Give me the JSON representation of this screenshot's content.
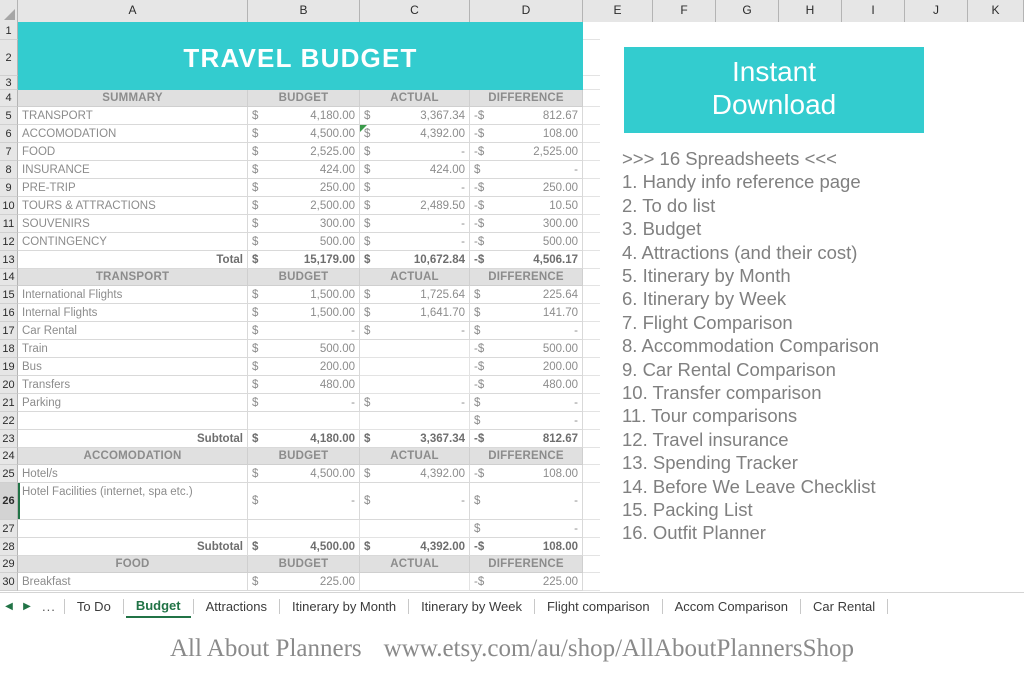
{
  "grid": {
    "column_headers": [
      "A",
      "B",
      "C",
      "D",
      "E",
      "F",
      "G",
      "H",
      "I",
      "J",
      "K"
    ],
    "row_numbers": [
      "1",
      "2",
      "3",
      "4",
      "5",
      "6",
      "7",
      "8",
      "9",
      "10",
      "11",
      "12",
      "13",
      "14",
      "15",
      "16",
      "17",
      "18",
      "19",
      "20",
      "21",
      "22",
      "23",
      "24",
      "25",
      "26",
      "27",
      "28",
      "29",
      "30"
    ],
    "selected_row": "26"
  },
  "banner": {
    "title": "TRAVEL BUDGET",
    "color": "#33cccf"
  },
  "summary": {
    "header": {
      "label": "SUMMARY",
      "budget": "BUDGET",
      "actual": "ACTUAL",
      "difference": "DIFFERENCE"
    },
    "rows": [
      {
        "label": "TRANSPORT",
        "budget_sym": "$",
        "budget": "4,180.00",
        "actual_sym": "$",
        "actual": "3,367.34",
        "diff_sym": "-$",
        "diff": "812.67",
        "comment": false
      },
      {
        "label": "ACCOMODATION",
        "budget_sym": "$",
        "budget": "4,500.00",
        "actual_sym": "$",
        "actual": "4,392.00",
        "diff_sym": "-$",
        "diff": "108.00",
        "comment": true
      },
      {
        "label": "FOOD",
        "budget_sym": "$",
        "budget": "2,525.00",
        "actual_sym": "$",
        "actual": "-",
        "diff_sym": "-$",
        "diff": "2,525.00",
        "comment": false
      },
      {
        "label": "INSURANCE",
        "budget_sym": "$",
        "budget": "424.00",
        "actual_sym": "$",
        "actual": "424.00",
        "diff_sym": "$",
        "diff": "-",
        "comment": false
      },
      {
        "label": "PRE-TRIP",
        "budget_sym": "$",
        "budget": "250.00",
        "actual_sym": "$",
        "actual": "-",
        "diff_sym": "-$",
        "diff": "250.00",
        "comment": false
      },
      {
        "label": "TOURS & ATTRACTIONS",
        "budget_sym": "$",
        "budget": "2,500.00",
        "actual_sym": "$",
        "actual": "2,489.50",
        "diff_sym": "-$",
        "diff": "10.50",
        "comment": false
      },
      {
        "label": "SOUVENIRS",
        "budget_sym": "$",
        "budget": "300.00",
        "actual_sym": "$",
        "actual": "-",
        "diff_sym": "-$",
        "diff": "300.00",
        "comment": false
      },
      {
        "label": "CONTINGENCY",
        "budget_sym": "$",
        "budget": "500.00",
        "actual_sym": "$",
        "actual": "-",
        "diff_sym": "-$",
        "diff": "500.00",
        "comment": false
      }
    ],
    "total": {
      "label": "Total",
      "budget_sym": "$",
      "budget": "15,179.00",
      "actual_sym": "$",
      "actual": "10,672.84",
      "diff_sym": "-$",
      "diff": "4,506.17"
    }
  },
  "transport": {
    "header": {
      "label": "TRANSPORT",
      "budget": "BUDGET",
      "actual": "ACTUAL",
      "difference": "DIFFERENCE"
    },
    "rows": [
      {
        "label": "International Flights",
        "budget_sym": "$",
        "budget": "1,500.00",
        "actual_sym": "$",
        "actual": "1,725.64",
        "diff_sym": "$",
        "diff": "225.64"
      },
      {
        "label": "Internal Flights",
        "budget_sym": "$",
        "budget": "1,500.00",
        "actual_sym": "$",
        "actual": "1,641.70",
        "diff_sym": "$",
        "diff": "141.70"
      },
      {
        "label": "Car Rental",
        "budget_sym": "$",
        "budget": "-",
        "actual_sym": "$",
        "actual": "-",
        "diff_sym": "$",
        "diff": "-"
      },
      {
        "label": "Train",
        "budget_sym": "$",
        "budget": "500.00",
        "actual_sym": "",
        "actual": "",
        "diff_sym": "-$",
        "diff": "500.00"
      },
      {
        "label": "Bus",
        "budget_sym": "$",
        "budget": "200.00",
        "actual_sym": "",
        "actual": "",
        "diff_sym": "-$",
        "diff": "200.00"
      },
      {
        "label": "Transfers",
        "budget_sym": "$",
        "budget": "480.00",
        "actual_sym": "",
        "actual": "",
        "diff_sym": "-$",
        "diff": "480.00"
      },
      {
        "label": "Parking",
        "budget_sym": "$",
        "budget": "-",
        "actual_sym": "$",
        "actual": "-",
        "diff_sym": "$",
        "diff": "-"
      },
      {
        "label": "",
        "budget_sym": "",
        "budget": "",
        "actual_sym": "",
        "actual": "",
        "diff_sym": "$",
        "diff": "-"
      }
    ],
    "subtotal": {
      "label": "Subtotal",
      "budget_sym": "$",
      "budget": "4,180.00",
      "actual_sym": "$",
      "actual": "3,367.34",
      "diff_sym": "-$",
      "diff": "812.67"
    }
  },
  "accommodation": {
    "header": {
      "label": "ACCOMODATION",
      "budget": "BUDGET",
      "actual": "ACTUAL",
      "difference": "DIFFERENCE"
    },
    "rows": [
      {
        "label": "Hotel/s",
        "budget_sym": "$",
        "budget": "4,500.00",
        "actual_sym": "$",
        "actual": "4,392.00",
        "diff_sym": "-$",
        "diff": "108.00"
      },
      {
        "label": "Hotel Facilities (internet, spa etc.)",
        "budget_sym": "$",
        "budget": "-",
        "actual_sym": "$",
        "actual": "-",
        "diff_sym": "$",
        "diff": "-"
      },
      {
        "label": "",
        "budget_sym": "",
        "budget": "",
        "actual_sym": "",
        "actual": "",
        "diff_sym": "$",
        "diff": "-"
      }
    ],
    "subtotal": {
      "label": "Subtotal",
      "budget_sym": "$",
      "budget": "4,500.00",
      "actual_sym": "$",
      "actual": "4,392.00",
      "diff_sym": "-$",
      "diff": "108.00"
    }
  },
  "food": {
    "header": {
      "label": "FOOD",
      "budget": "BUDGET",
      "actual": "ACTUAL",
      "difference": "DIFFERENCE"
    },
    "rows": [
      {
        "label": "Breakfast",
        "budget_sym": "$",
        "budget": "225.00",
        "actual_sym": "",
        "actual": "",
        "diff_sym": "-$",
        "diff": "225.00"
      }
    ]
  },
  "promo": {
    "banner_line1": "Instant",
    "banner_line2": "Download",
    "heading": ">>> 16 Spreadsheets <<<",
    "items": [
      "1. Handy info reference page",
      "2. To do list",
      "3. Budget",
      "4. Attractions (and their cost)",
      "5. Itinerary by Month",
      "6. Itinerary by Week",
      "7. Flight Comparison",
      "8. Accommodation Comparison",
      "9. Car Rental Comparison",
      "10. Transfer comparison",
      "11. Tour comparisons",
      "12. Travel insurance",
      "13. Spending Tracker",
      "14. Before We Leave Checklist",
      "15. Packing List",
      "16. Outfit Planner"
    ]
  },
  "tabs": {
    "prev_icon": "◀",
    "next_icon": "▶",
    "overflow": "...",
    "items": [
      {
        "label": "To Do",
        "active": false
      },
      {
        "label": "Budget",
        "active": true
      },
      {
        "label": "Attractions",
        "active": false
      },
      {
        "label": "Itinerary by Month",
        "active": false
      },
      {
        "label": "Itinerary by Week",
        "active": false
      },
      {
        "label": "Flight comparison",
        "active": false
      },
      {
        "label": "Accom Comparison",
        "active": false
      },
      {
        "label": "Car Rental",
        "active": false
      }
    ]
  },
  "footer": {
    "brand": "All About Planners",
    "url": "www.etsy.com/au/shop/AllAboutPlannersShop"
  }
}
